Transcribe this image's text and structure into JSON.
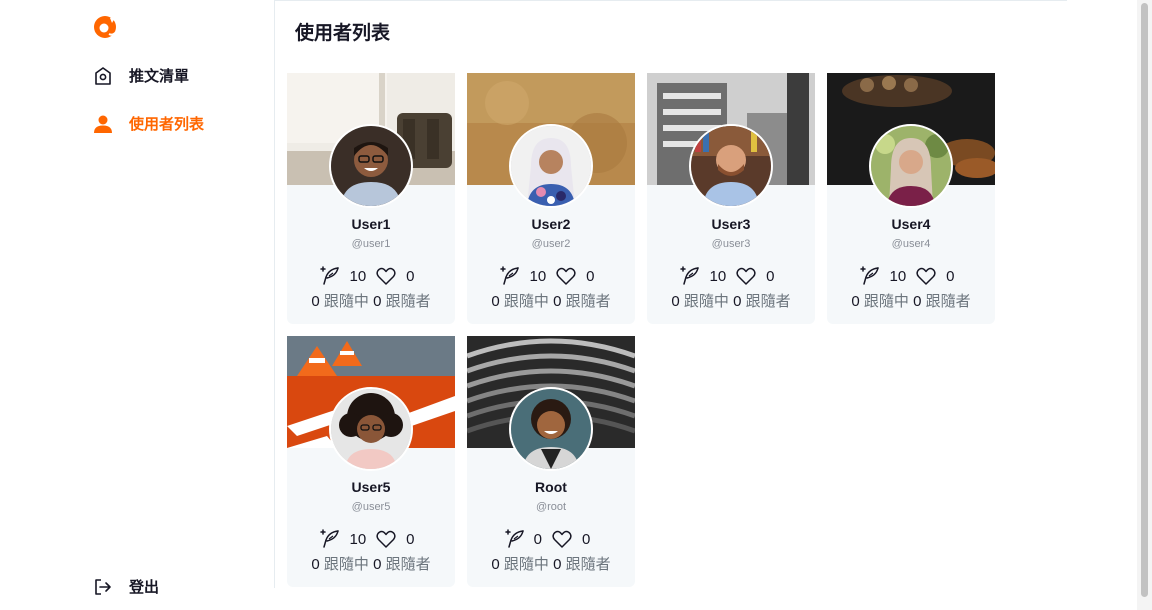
{
  "sidebar": {
    "items": [
      {
        "label": "推文清單",
        "icon": "home-icon",
        "active": false
      },
      {
        "label": "使用者列表",
        "icon": "user-icon",
        "active": true
      }
    ],
    "logout_label": "登出",
    "accent": "#FF6600"
  },
  "main": {
    "title": "使用者列表",
    "users": [
      {
        "name": "User1",
        "account": "@user1",
        "tweets": "10",
        "likes": "0",
        "following": "0",
        "following_label": "跟隨中",
        "followers": "0",
        "followers_label": "跟隨者"
      },
      {
        "name": "User2",
        "account": "@user2",
        "tweets": "10",
        "likes": "0",
        "following": "0",
        "following_label": "跟隨中",
        "followers": "0",
        "followers_label": "跟隨者"
      },
      {
        "name": "User3",
        "account": "@user3",
        "tweets": "10",
        "likes": "0",
        "following": "0",
        "following_label": "跟隨中",
        "followers": "0",
        "followers_label": "跟隨者"
      },
      {
        "name": "User4",
        "account": "@user4",
        "tweets": "10",
        "likes": "0",
        "following": "0",
        "following_label": "跟隨中",
        "followers": "0",
        "followers_label": "跟隨者"
      },
      {
        "name": "User5",
        "account": "@user5",
        "tweets": "10",
        "likes": "0",
        "following": "0",
        "following_label": "跟隨中",
        "followers": "0",
        "followers_label": "跟隨者"
      },
      {
        "name": "Root",
        "account": "@root",
        "tweets": "0",
        "likes": "0",
        "following": "0",
        "following_label": "跟隨中",
        "followers": "0",
        "followers_label": "跟隨者"
      }
    ]
  }
}
